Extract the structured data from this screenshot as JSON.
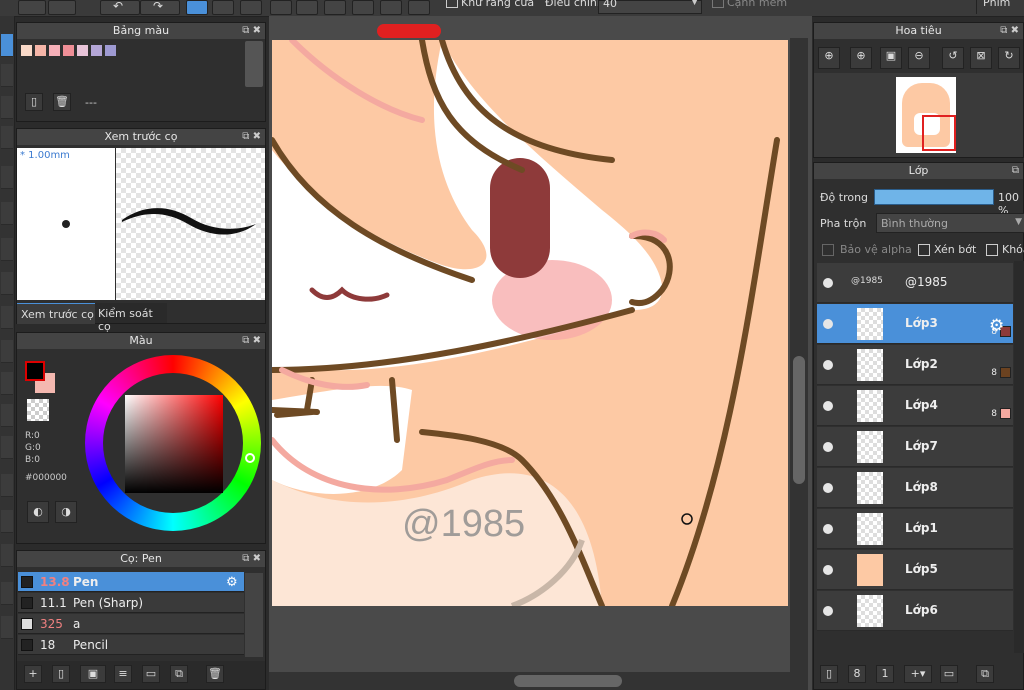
{
  "toolbar": {
    "antialias_label": "Khử răng cưa",
    "adjust_label": "Điều chỉnh",
    "adjust_value": "40",
    "soft_edge_label": "Cạnh mềm",
    "menu_right": "Phím"
  },
  "palette_panel": {
    "title": "Bảng màu",
    "colors": [
      "#f9d9c8",
      "#f5b5a8",
      "#f6b0b8",
      "#ef8f97",
      "#e8c4d8",
      "#b4a6d6",
      "#9e9ad2"
    ],
    "page_label": "---"
  },
  "brush_preview_panel": {
    "title": "Xem trước cọ",
    "size_label": "* 1.00mm",
    "tab_preview": "Xem trước cọ",
    "tab_control": "Kiểm soát cọ"
  },
  "color_panel": {
    "title": "Màu",
    "r": "R:0",
    "g": "G:0",
    "b": "B:0",
    "hex": "#000000",
    "primary": "#000000",
    "secondary": "#f4b8b0"
  },
  "brush_panel": {
    "title": "Cọ: Pen",
    "brushes": [
      {
        "size": "13.8",
        "name": "Pen"
      },
      {
        "size": "11.1",
        "name": "Pen (Sharp)"
      },
      {
        "size": "325",
        "name": "a"
      },
      {
        "size": "18",
        "name": "Pencil"
      }
    ]
  },
  "canvas": {
    "watermark": "@1985"
  },
  "navigator_panel": {
    "title": "Hoa tiêu"
  },
  "layer_panel": {
    "title": "Lớp",
    "opacity_label": "Độ trong",
    "opacity_value": "100 %",
    "blend_label": "Pha trộn",
    "blend_value": "Bình thường",
    "protect_alpha": "Bảo vệ alpha",
    "clipping": "Xén bớt",
    "lock": "Khóa",
    "layers": [
      {
        "name": "@1985",
        "thumb_text": "@1985",
        "num": "",
        "chip": ""
      },
      {
        "name": "Lớp3",
        "num": "8",
        "chip": "#8e3a3a"
      },
      {
        "name": "Lớp2",
        "num": "8",
        "chip": "#6b4220"
      },
      {
        "name": "Lớp4",
        "num": "8",
        "chip": "#f4a9a0"
      },
      {
        "name": "Lớp7",
        "num": "",
        "chip": ""
      },
      {
        "name": "Lớp8",
        "num": "",
        "chip": ""
      },
      {
        "name": "Lớp1",
        "num": "",
        "chip": ""
      },
      {
        "name": "Lớp5",
        "num": "",
        "chip": ""
      },
      {
        "name": "Lớp6",
        "num": "",
        "chip": ""
      }
    ]
  },
  "colors": {
    "accent": "#4a90d9",
    "skin": "#fdc9a4",
    "outline": "#6e4a24",
    "eye": "#8e3a3a"
  }
}
